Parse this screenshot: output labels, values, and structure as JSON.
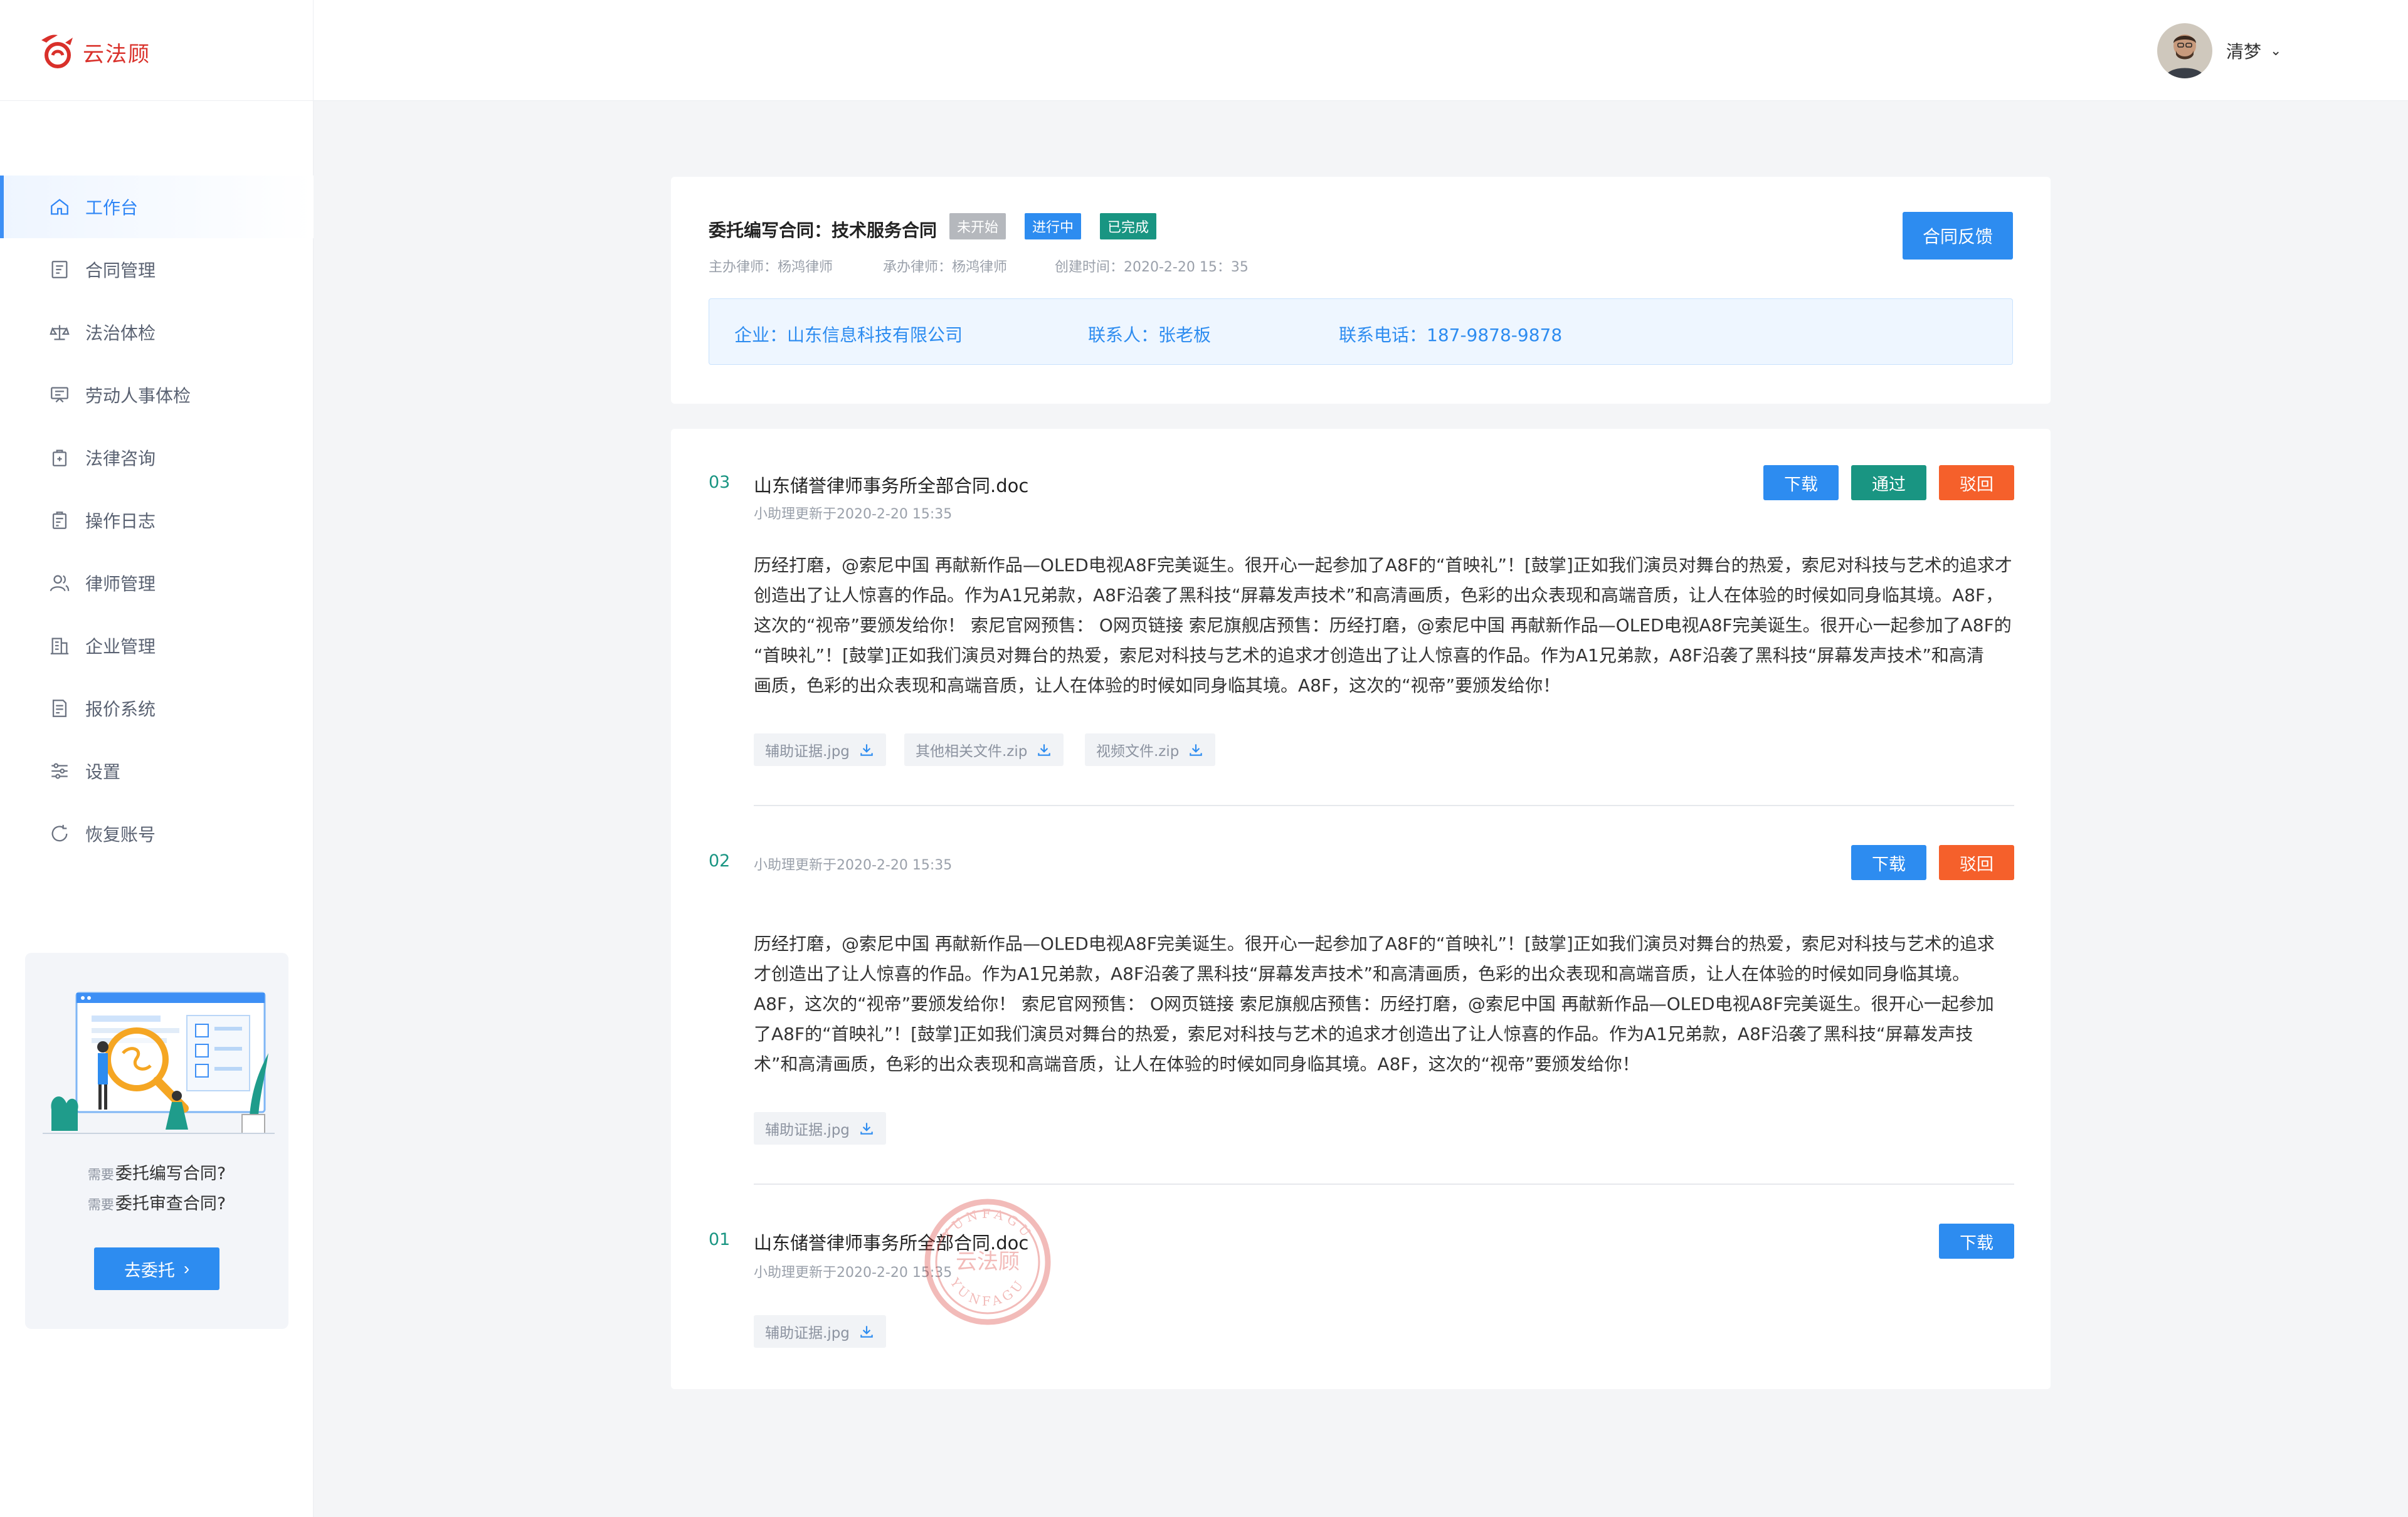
{
  "brand": {
    "name": "云法顾",
    "color": "#d9302a"
  },
  "accent": "#2d8cf0",
  "nav": {
    "items": [
      {
        "label": "工作台",
        "icon": "home-icon",
        "active": true
      },
      {
        "label": "合同管理",
        "icon": "contract-icon"
      },
      {
        "label": "法治体检",
        "icon": "scale-icon"
      },
      {
        "label": "劳动人事体检",
        "icon": "presentation-icon"
      },
      {
        "label": "法律咨询",
        "icon": "consult-icon"
      },
      {
        "label": "操作日志",
        "icon": "clipboard-icon"
      },
      {
        "label": "律师管理",
        "icon": "users-icon"
      },
      {
        "label": "企业管理",
        "icon": "building-icon"
      },
      {
        "label": "报价系统",
        "icon": "quote-icon"
      },
      {
        "label": "设置",
        "icon": "sliders-icon"
      },
      {
        "label": "恢复账号",
        "icon": "refresh-icon"
      }
    ]
  },
  "promo": {
    "prefix1": "需要",
    "line1": "委托编写合同?",
    "prefix2": "需要",
    "line2": "委托审查合同?",
    "button": "去委托"
  },
  "user": {
    "name": "清梦"
  },
  "task": {
    "title": "委托编写合同：技术服务合同",
    "tags": [
      {
        "label": "未开始",
        "color": "#b5b8bd"
      },
      {
        "label": "进行中",
        "color": "#2d8cf0"
      },
      {
        "label": "已完成",
        "color": "#199582"
      }
    ],
    "lead_lawyer": "主办律师：杨鸿律师",
    "handling_lawyer": "承办律师：杨鸿律师",
    "created": "创建时间：2020-2-20 15：35",
    "feedback_button": "合同反馈",
    "company": "企业：山东信息科技有限公司",
    "contact": "联系人：张老板",
    "phone": "联系电话：187-9878-9878"
  },
  "entries": [
    {
      "num": "03",
      "title": "山东储誉律师事务所全部合同.doc",
      "updated": "小助理更新于2020-2-20 15:35",
      "body": [
        "历经打磨，@索尼中国 再献新作品—OLED电视A8F完美诞生。很开心一起参加了A8F的“首映礼”！[鼓掌]正如我们演员对舞台的热爱，索尼对科技与艺术的追求才",
        "创造出了让人惊喜的作品。作为A1兄弟款，A8F沿袭了黑科技“屏幕发声技术”和高清画质，色彩的出众表现和高端音质，让人在体验的时候如同身临其境。A8F，",
        "这次的“视帝”要颁发给你！ 索尼官网预售： O网页链接 索尼旗舰店预售：历经打磨，@索尼中国 再献新作品—OLED电视A8F完美诞生。很开心一起参加了A8F的",
        "“首映礼”！[鼓掌]正如我们演员对舞台的热爱，索尼对科技与艺术的追求才创造出了让人惊喜的作品。作为A1兄弟款，A8F沿袭了黑科技“屏幕发声技术”和高清",
        "画质，色彩的出众表现和高端音质，让人在体验的时候如同身临其境。A8F，这次的“视帝”要颁发给你！"
      ],
      "attachments": [
        "辅助证据.jpg",
        "其他相关文件.zip",
        "视频文件.zip"
      ],
      "buttons": {
        "download": "下载",
        "approve": "通过",
        "reject": "驳回"
      }
    },
    {
      "num": "02",
      "updated": "小助理更新于2020-2-20 15:35",
      "body": [
        "历经打磨，@索尼中国 再献新作品—OLED电视A8F完美诞生。很开心一起参加了A8F的“首映礼”！[鼓掌]正如我们演员对舞台的热爱，索尼对科技与艺术的追求",
        "才创造出了让人惊喜的作品。作为A1兄弟款，A8F沿袭了黑科技“屏幕发声技术”和高清画质，色彩的出众表现和高端音质，让人在体验的时候如同身临其境。",
        "A8F，这次的“视帝”要颁发给你！ 索尼官网预售： O网页链接 索尼旗舰店预售：历经打磨，@索尼中国 再献新作品—OLED电视A8F完美诞生。很开心一起参加",
        "了A8F的“首映礼”！[鼓掌]正如我们演员对舞台的热爱，索尼对科技与艺术的追求才创造出了让人惊喜的作品。作为A1兄弟款，A8F沿袭了黑科技“屏幕发声技",
        "术”和高清画质，色彩的出众表现和高端音质，让人在体验的时候如同身临其境。A8F，这次的“视帝”要颁发给你！"
      ],
      "attachments": [
        "辅助证据.jpg"
      ],
      "buttons": {
        "download": "下载",
        "reject": "驳回"
      }
    },
    {
      "num": "01",
      "title": "山东储誉律师事务所全部合同.doc",
      "updated": "小助理更新于2020-2-20 15:35",
      "attachments": [
        "辅助证据.jpg"
      ],
      "buttons": {
        "download": "下载"
      },
      "stamp": {
        "top_text": "YUNFAGU",
        "center_text": "云法顾",
        "bottom_text": "YUNFAGU"
      }
    }
  ]
}
